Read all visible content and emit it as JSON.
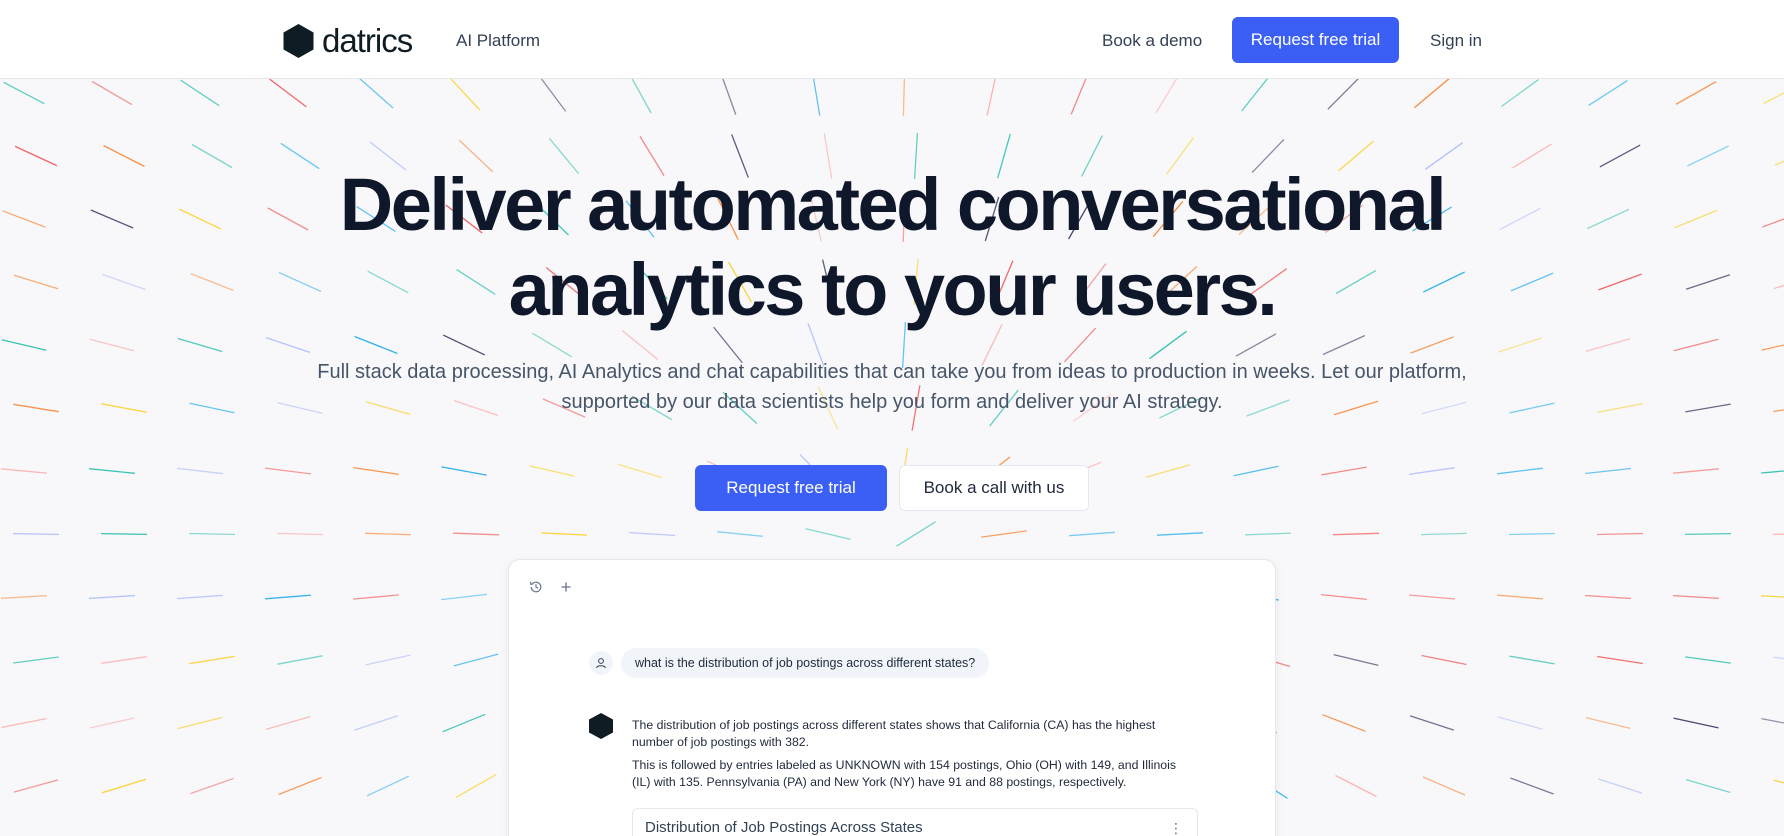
{
  "nav": {
    "logo_text": "datrics",
    "platform_label": "AI Platform",
    "demo_label": "Book a demo",
    "trial_label": "Request free trial",
    "signin_label": "Sign in"
  },
  "hero": {
    "title_line1": "Deliver automated conversational",
    "title_line2": "analytics to your users.",
    "subtitle": "Full stack data processing, AI Analytics and chat capabilities that can take you from ideas to production in weeks. Let our platform, supported by our data scientists help you form and deliver your AI strategy.",
    "primary_cta": "Request free trial",
    "secondary_cta": "Book a call with us"
  },
  "demo": {
    "toolbar_icons": [
      "history-icon",
      "plus-icon"
    ],
    "user_question": "what is the distribution of job postings across different states?",
    "answer_p1": "The distribution of job postings across different states shows that California (CA) has the highest number of job postings with 382.",
    "answer_p2": "This is followed by entries labeled as UNKNOWN with 154 postings, Ohio (OH) with 149, and Illinois (IL) with 135. Pennsylvania (PA) and New York (NY) have 91 and 88 postings, respectively.",
    "chart_title": "Distribution of Job Postings Across States",
    "chart_menu": "⋮"
  },
  "colors": {
    "accent": "#3b5ef5",
    "text_dark": "#0f172a",
    "text_muted": "#475569",
    "background": "#f8f8fa",
    "deco_palette": [
      "#ef4444",
      "#f97316",
      "#facc15",
      "#14b8a6",
      "#0ea5e9",
      "#1e1b4b",
      "#a5b4fc",
      "#fca5a5"
    ]
  }
}
